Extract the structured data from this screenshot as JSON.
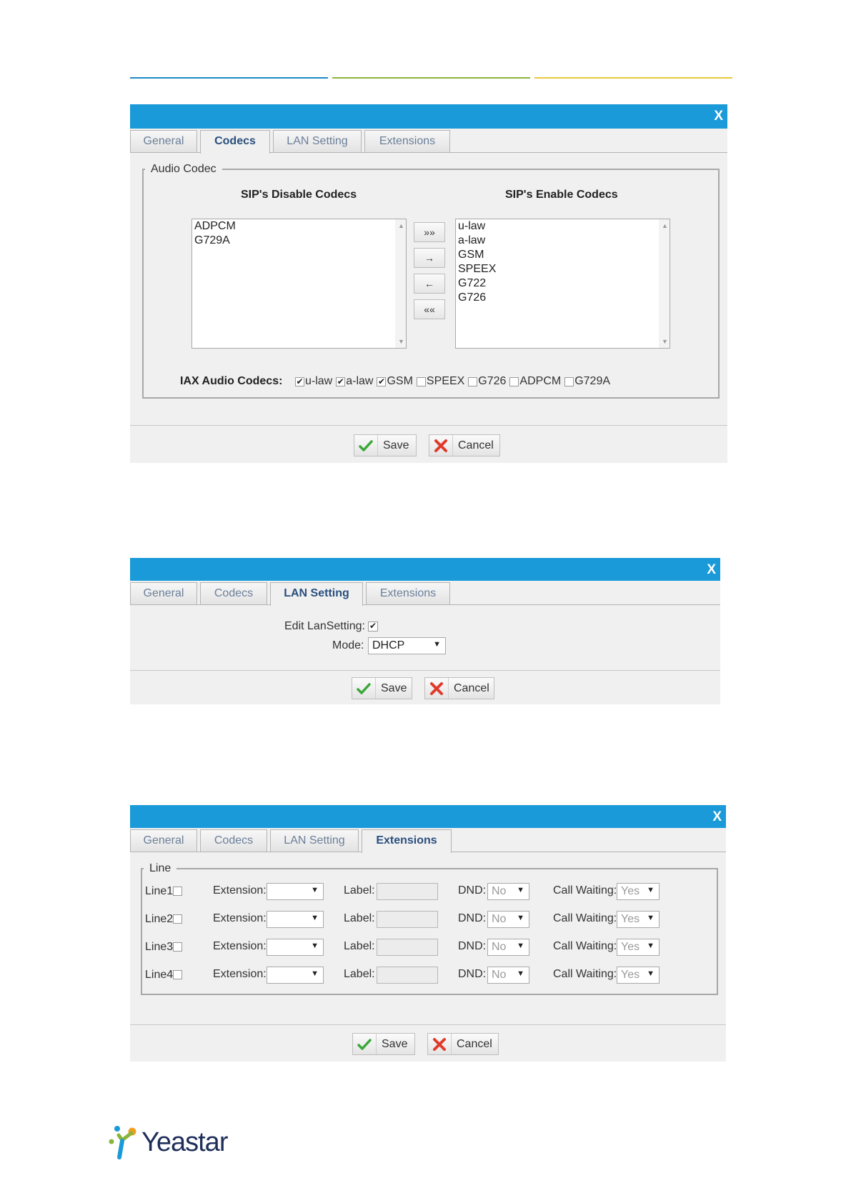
{
  "colors": {
    "titlebar": "#1a9ad8",
    "line_blue": "#1a8ac4",
    "line_green": "#8ab43a",
    "line_yellow": "#e8c63a"
  },
  "tabs": {
    "general": "General",
    "codecs": "Codecs",
    "lan": "LAN Setting",
    "extensions": "Extensions"
  },
  "close_label": "X",
  "buttons": {
    "save": "Save",
    "cancel": "Cancel"
  },
  "codecs_dialog": {
    "active_tab": "Codecs",
    "legend": "Audio Codec",
    "disable_header": "SIP's Disable Codecs",
    "enable_header": "SIP's Enable Codecs",
    "disabled_codecs": [
      "ADPCM",
      "G729A"
    ],
    "enabled_codecs": [
      "u-law",
      "a-law",
      "GSM",
      "SPEEX",
      "G722",
      "G726"
    ],
    "move_buttons": [
      "»»",
      "→",
      "←",
      "««"
    ],
    "iax_label": "IAX Audio Codecs:",
    "iax_codecs": [
      {
        "label": "u-law",
        "checked": true
      },
      {
        "label": "a-law",
        "checked": true
      },
      {
        "label": "GSM",
        "checked": true
      },
      {
        "label": "SPEEX",
        "checked": false
      },
      {
        "label": "G726",
        "checked": false
      },
      {
        "label": "ADPCM",
        "checked": false
      },
      {
        "label": "G729A",
        "checked": false
      }
    ]
  },
  "lan_dialog": {
    "active_tab": "LAN Setting",
    "edit_label": "Edit LanSetting:",
    "edit_checked": true,
    "mode_label": "Mode:",
    "mode_value": "DHCP"
  },
  "ext_dialog": {
    "active_tab": "Extensions",
    "legend": "Line",
    "extension_label": "Extension:",
    "label_label": "Label:",
    "dnd_label": "DND:",
    "cw_label": "Call Waiting:",
    "lines": [
      {
        "name": "Line1",
        "extension": "",
        "label": "",
        "dnd": "No",
        "call_waiting": "Yes"
      },
      {
        "name": "Line2",
        "extension": "",
        "label": "",
        "dnd": "No",
        "call_waiting": "Yes"
      },
      {
        "name": "Line3",
        "extension": "",
        "label": "",
        "dnd": "No",
        "call_waiting": "Yes"
      },
      {
        "name": "Line4",
        "extension": "",
        "label": "",
        "dnd": "No",
        "call_waiting": "Yes"
      }
    ]
  },
  "logo": {
    "text": "Yeastar"
  }
}
